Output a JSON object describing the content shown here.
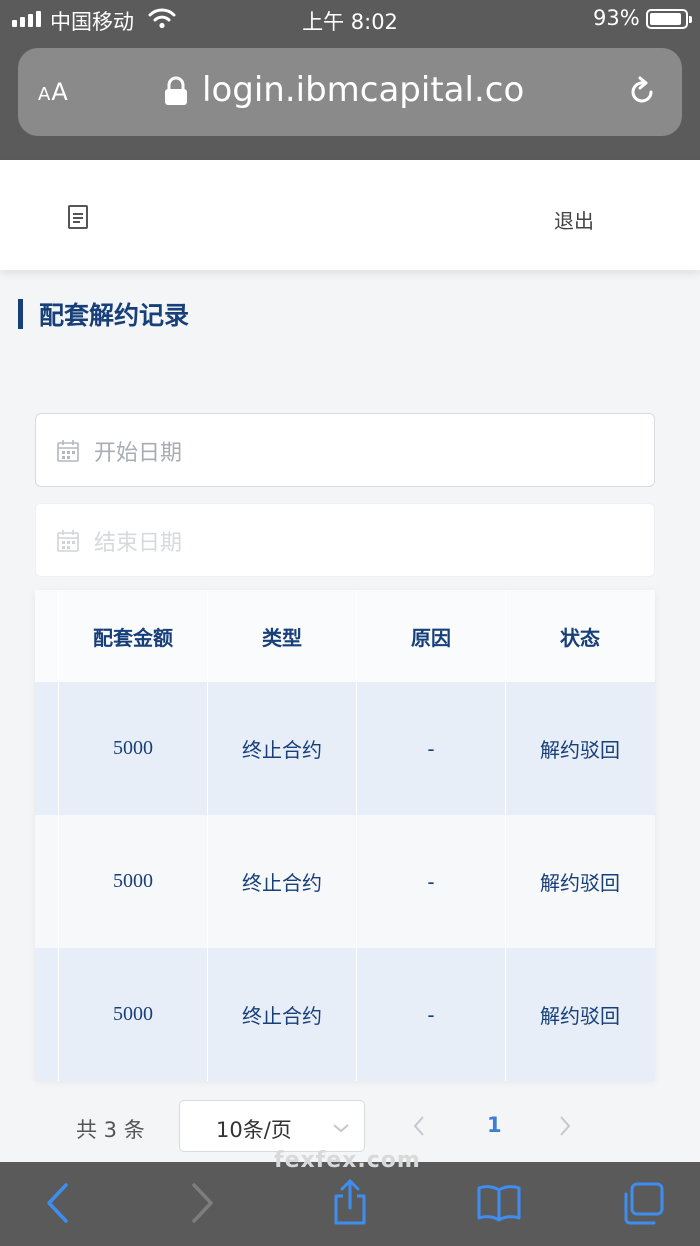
{
  "status_bar": {
    "carrier": "中国移动",
    "time": "上午 8:02",
    "battery": "93%"
  },
  "browser": {
    "aa_label": "AA",
    "url": "login.ibmcapital.co"
  },
  "header": {
    "logout_label": "退出"
  },
  "page": {
    "title": "配套解约记录",
    "accent_color": "#173f7a"
  },
  "filters": {
    "start_date_placeholder": "开始日期",
    "end_date_placeholder": "结束日期"
  },
  "table": {
    "columns": [
      "配套金额",
      "类型",
      "原因",
      "状态"
    ],
    "rows": [
      [
        "5000",
        "终止合约",
        "-",
        "解约驳回"
      ],
      [
        "5000",
        "终止合约",
        "-",
        "解约驳回"
      ],
      [
        "5000",
        "终止合约",
        "-",
        "解约驳回"
      ]
    ]
  },
  "pagination": {
    "total": "共 3 条",
    "page_size": "10条/页",
    "current_page": "1"
  },
  "footer": {
    "site_text": "fexfex.com"
  }
}
